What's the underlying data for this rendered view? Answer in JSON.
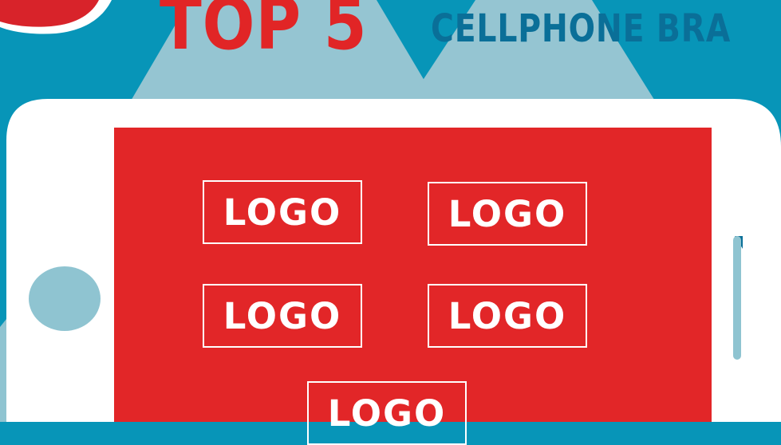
{
  "title": {
    "top": "TOP 5",
    "subtitle": "CELLPHONE BRA"
  },
  "logos": [
    "LOGO",
    "LOGO",
    "LOGO",
    "LOGO",
    "LOGO"
  ],
  "colors": {
    "background": "#0795b8",
    "accent_red": "#e22628",
    "title_blue": "#0a6f98",
    "light_blue": "#8fc4d1",
    "phone_white": "#ffffff"
  }
}
